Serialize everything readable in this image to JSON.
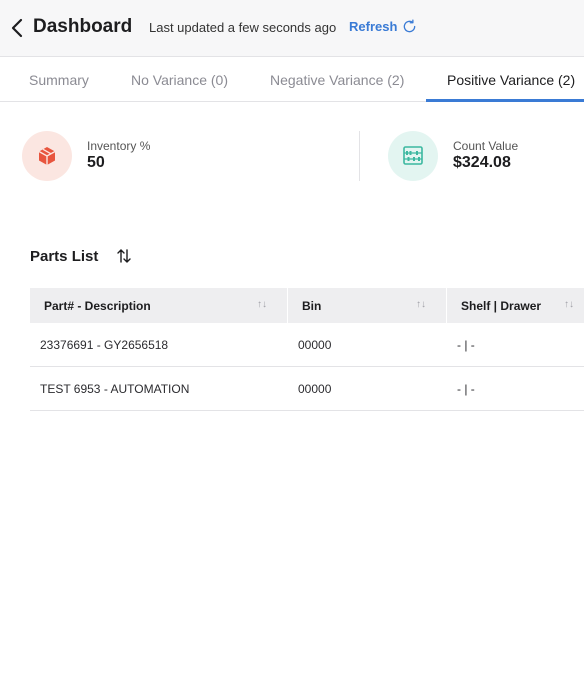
{
  "header": {
    "title": "Dashboard",
    "last_updated": "Last updated a few seconds ago",
    "refresh_label": "Refresh"
  },
  "tabs": [
    {
      "label": "Summary",
      "active": false
    },
    {
      "label": "No Variance (0)",
      "active": false
    },
    {
      "label": "Negative Variance (2)",
      "active": false
    },
    {
      "label": "Positive Variance (2)",
      "active": true
    }
  ],
  "stats": {
    "inventory": {
      "label": "Inventory %",
      "value": "50",
      "icon": "box-icon",
      "color": "#e8553e"
    },
    "count": {
      "label": "Count Value",
      "value": "$324.08",
      "icon": "abacus-icon",
      "color": "#3bb8a0"
    }
  },
  "parts": {
    "title": "Parts List",
    "columns": [
      "Part# - Description",
      "Bin",
      "Shelf | Drawer"
    ],
    "rows": [
      {
        "part": "23376691 - GY2656518",
        "bin": "00000",
        "shelf": "- | -"
      },
      {
        "part": "TEST 6953 - AUTOMATION",
        "bin": "00000",
        "shelf": "- | -"
      }
    ]
  },
  "colors": {
    "accent": "#3a7bd5",
    "header_bg": "#f7f7f8",
    "table_header_bg": "#eeeef0"
  }
}
